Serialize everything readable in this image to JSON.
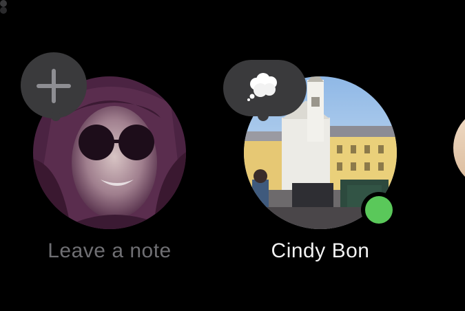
{
  "stories": [
    {
      "kind": "self",
      "label": "Leave a note",
      "action_icon": "plus-icon"
    },
    {
      "kind": "contact",
      "label": "Cindy Bon",
      "note_icon": "thought-cloud-icon",
      "online": true
    }
  ],
  "colors": {
    "background": "#000000",
    "bubble": "#3a3a3c",
    "muted_label": "#6f6f73",
    "label": "#f2f2f2",
    "online": "#5ac85a"
  }
}
